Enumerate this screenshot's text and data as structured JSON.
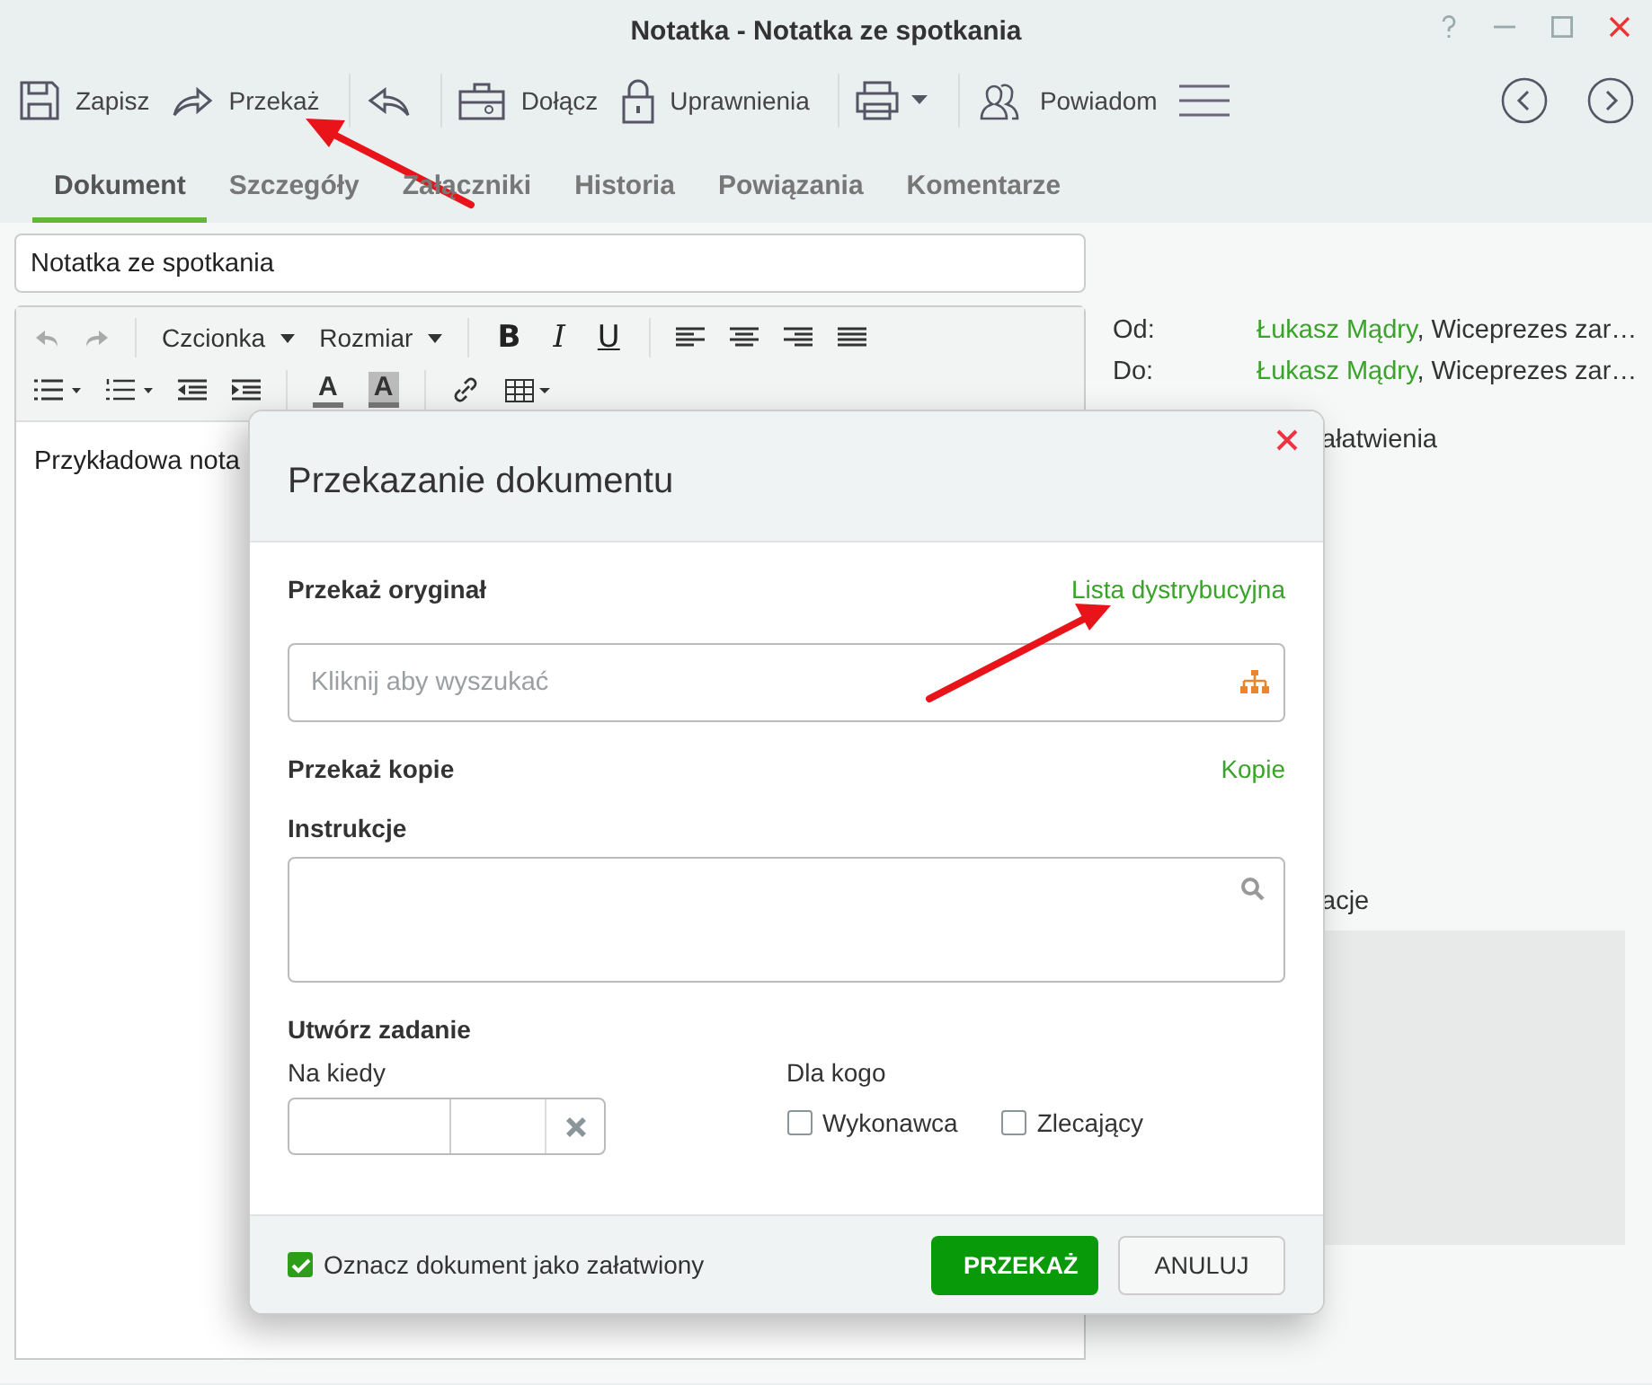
{
  "window": {
    "title": "Notatka - Notatka ze spotkania"
  },
  "toolbar": [
    {
      "kind": "save",
      "label": "Zapisz"
    },
    {
      "kind": "forward",
      "label": "Przekaż"
    },
    {
      "kind": "reply"
    },
    {
      "kind": "attach",
      "label": "Dołącz"
    },
    {
      "kind": "lock",
      "label": "Uprawnienia"
    },
    {
      "kind": "print"
    },
    {
      "kind": "notify",
      "label": "Powiadom"
    },
    {
      "kind": "menu"
    }
  ],
  "tabs": [
    {
      "label": "Dokument",
      "selected": true
    },
    {
      "label": "Szczegóły",
      "selected": false
    },
    {
      "label": "Załączniki",
      "selected": false
    },
    {
      "label": "Historia",
      "selected": false
    },
    {
      "label": "Powiązania",
      "selected": false
    },
    {
      "label": "Komentarze",
      "selected": false
    }
  ],
  "document": {
    "title": "Notatka ze spotkania",
    "font": "Czcionka",
    "size": "Rozmiar",
    "format": [
      "B",
      "I",
      "U"
    ],
    "colors": [
      "A",
      "A"
    ],
    "body": "Przykładowa nota"
  },
  "details": {
    "rows": [
      {
        "label": "Od:",
        "person": "Łukasz Mądry",
        "rest": ", Wiceprezes zar…"
      },
      {
        "label": "Do:",
        "person": "Łukasz Mądry",
        "rest": ", Wiceprezes zar…"
      }
    ],
    "fragments": [
      "ałatwienia",
      "acje"
    ]
  },
  "dialog": {
    "title": "Przekazanie dokumentu",
    "original_label": "Przekaż oryginał",
    "distribution_link": "Lista dystrybucyjna",
    "search": {
      "placeholder": "Kliknij aby wyszukać"
    },
    "copies_label": "Przekaż kopie",
    "copies_link": "Kopie",
    "instructions_label": "Instrukcje",
    "task_label": "Utwórz zadanie",
    "when_label": "Na kiedy",
    "whom_label": "Dla kogo",
    "whom": [
      {
        "label": "Wykonawca",
        "checked": false
      },
      {
        "label": "Zlecający",
        "checked": false
      }
    ],
    "mark_done": {
      "label": "Oznacz dokument jako załatwiony",
      "checked": true
    },
    "buttons": [
      {
        "label": "PRZEKAŻ",
        "kind": "primary"
      },
      {
        "label": "ANULUJ",
        "kind": "secondary"
      }
    ]
  }
}
